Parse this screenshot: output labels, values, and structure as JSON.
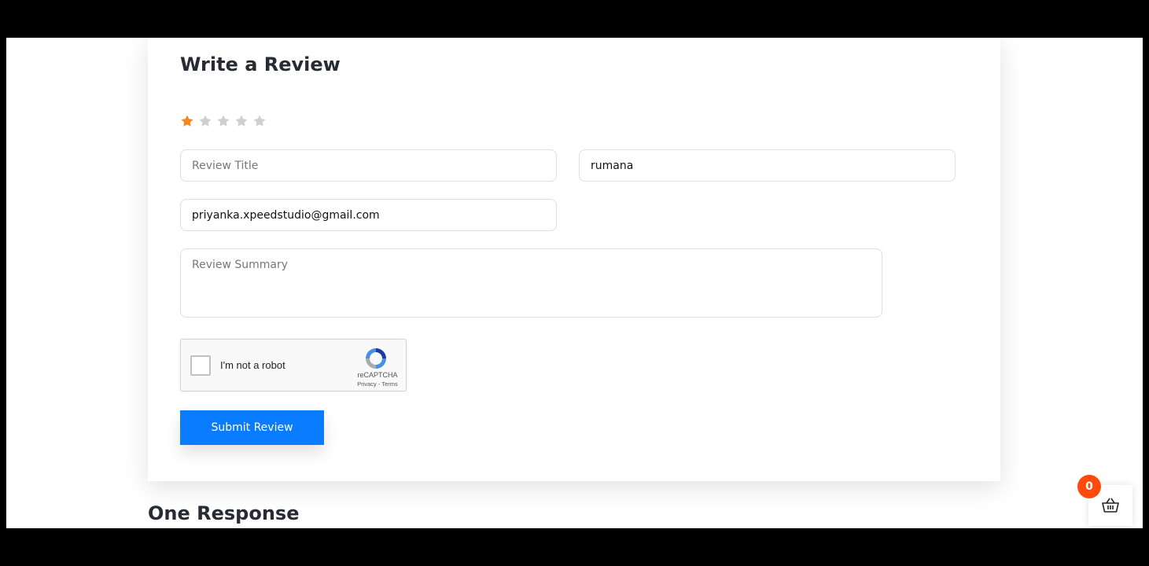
{
  "review_form": {
    "heading": "Write a Review",
    "rating": {
      "value": 1,
      "max": 5,
      "active_color": "#f5851f",
      "inactive_color": "#cfcfcf"
    },
    "title_placeholder": "Review Title",
    "name_value": "rumana",
    "email_value": "priyanka.xpeedstudio@gmail.com",
    "summary_placeholder": "Review Summary",
    "submit_label": "Submit Review"
  },
  "recaptcha": {
    "label": "I'm not a robot",
    "brand": "reCAPTCHA",
    "privacy": "Privacy",
    "separator": "-",
    "terms": "Terms"
  },
  "responses": {
    "heading": "One Response"
  },
  "cart": {
    "count": "0",
    "icon": "basket-icon",
    "badge_color": "#ff4a0d"
  },
  "colors": {
    "accent": "#0a7cff",
    "star_active": "#f5851f"
  }
}
